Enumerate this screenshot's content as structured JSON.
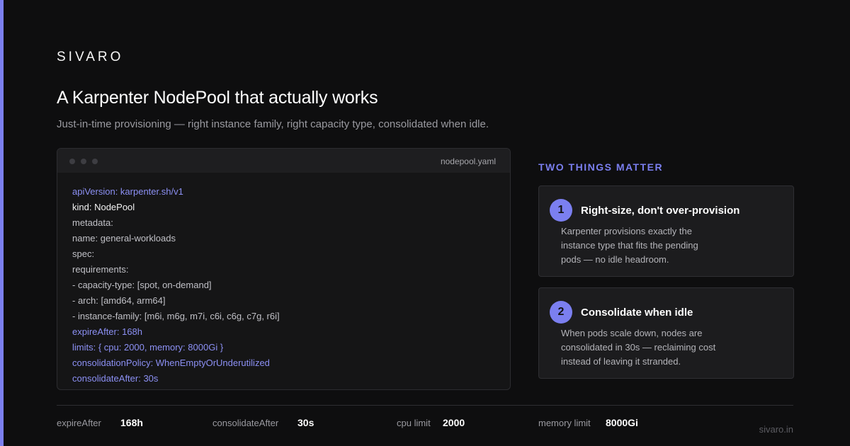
{
  "brand": "SIVARO",
  "title": "A Karpenter NodePool that actually works",
  "subtitle": "Just-in-time provisioning — right instance family, right capacity type, consolidated when idle.",
  "code": {
    "filename": "nodepool.yaml",
    "lines": [
      {
        "text": "apiVersion: karpenter.sh/v1",
        "style": "accent"
      },
      {
        "text": "kind: NodePool",
        "style": "bright"
      },
      {
        "text": "metadata:",
        "style": "normal"
      },
      {
        "text": "name: general-workloads",
        "style": "normal"
      },
      {
        "text": "spec:",
        "style": "normal"
      },
      {
        "text": "requirements:",
        "style": "normal"
      },
      {
        "text": "- capacity-type: [spot, on-demand]",
        "style": "normal"
      },
      {
        "text": "- arch: [amd64, arm64]",
        "style": "normal"
      },
      {
        "text": "- instance-family: [m6i, m6g, m7i, c6i, c6g, c7g, r6i]",
        "style": "normal"
      },
      {
        "text": "expireAfter: 168h",
        "style": "accent"
      },
      {
        "text": "limits: { cpu: 2000, memory: 8000Gi }",
        "style": "accent"
      },
      {
        "text": "consolidationPolicy: WhenEmptyOrUnderutilized",
        "style": "accent"
      },
      {
        "text": "consolidateAfter: 30s",
        "style": "accent"
      }
    ]
  },
  "section_label": "TWO THINGS MATTER",
  "cards": [
    {
      "number": "1",
      "title": "Right-size, don't over-provision",
      "description": "Karpenter provisions exactly the instance type that fits the pending pods — no idle headroom."
    },
    {
      "number": "2",
      "title": "Consolidate when idle",
      "description": "When pods scale down, nodes are consolidated in 30s — reclaiming cost instead of leaving it stranded."
    }
  ],
  "stats": [
    {
      "label": "expireAfter",
      "value": "168h"
    },
    {
      "label": "consolidateAfter",
      "value": "30s"
    },
    {
      "label": "cpu limit",
      "value": "2000"
    },
    {
      "label": "memory limit",
      "value": "8000Gi"
    }
  ],
  "domain": "sivaro.in",
  "colors": {
    "accent": "#7b7ff0",
    "background": "#0e0e0f",
    "card": "#1c1c1e"
  }
}
